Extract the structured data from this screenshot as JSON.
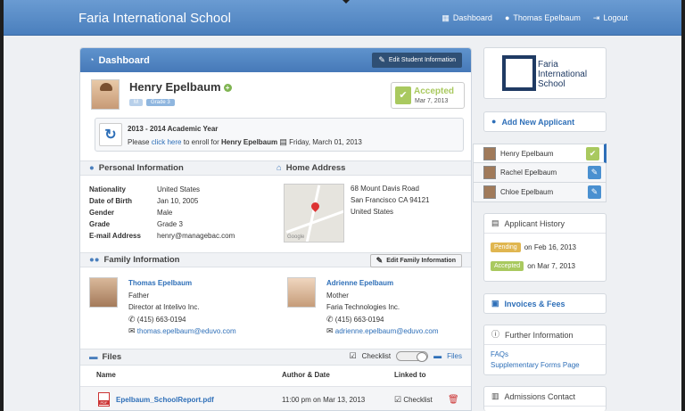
{
  "header": {
    "brand": "Faria International School",
    "nav": [
      {
        "label": "Dashboard",
        "icon": "dashboard-icon"
      },
      {
        "label": "Thomas Epelbaum",
        "icon": "user-icon"
      },
      {
        "label": "Logout",
        "icon": "logout-icon"
      }
    ]
  },
  "dashboard": {
    "title": "Dashboard",
    "edit_student_label": "Edit Student Information"
  },
  "student": {
    "name": "Henry Epelbaum",
    "tag_short": "M",
    "tag_grade": "Grade 3",
    "status": "Accepted",
    "status_date": "Mar 7, 2013"
  },
  "enroll": {
    "year": "2013 - 2014 Academic Year",
    "prefix": "Please",
    "link": "click here",
    "middle": "to enroll for",
    "name": "Henry Epelbaum",
    "date": "Friday, March 01, 2013"
  },
  "personal": {
    "title": "Personal Information",
    "fields": [
      {
        "k": "Nationality",
        "v": "United States"
      },
      {
        "k": "Date of Birth",
        "v": "Jan 10, 2005"
      },
      {
        "k": "Gender",
        "v": "Male"
      },
      {
        "k": "Grade",
        "v": "Grade 3"
      },
      {
        "k": "E-mail Address",
        "v": "henry@managebac.com"
      }
    ]
  },
  "address": {
    "title": "Home Address",
    "line1": "68 Mount Davis Road",
    "line2": "San Francisco CA 94121",
    "line3": "United States",
    "map_label": "Google"
  },
  "family": {
    "title": "Family Information",
    "edit_label": "Edit Family Information",
    "father": {
      "name": "Thomas Epelbaum",
      "role": "Father",
      "job": "Director at Intelivo Inc.",
      "phone": "(415) 663-0194",
      "email": "thomas.epelbaum@eduvo.com"
    },
    "mother": {
      "name": "Adrienne Epelbaum",
      "role": "Mother",
      "job": "Faria Technologies Inc.",
      "phone": "(415) 663-0194",
      "email": "adrienne.epelbaum@eduvo.com"
    }
  },
  "files": {
    "title": "Files",
    "checklist_label": "Checklist",
    "files_label": "Files",
    "col_name": "Name",
    "col_author": "Author & Date",
    "col_linked": "Linked to",
    "row": {
      "name": "Epelbaum_SchoolReport.pdf",
      "date": "11:00 pm on Mar 13, 2013",
      "linked": "Checklist"
    }
  },
  "sidebar": {
    "logo_line1": "Faria",
    "logo_line2": "International",
    "logo_line3": "School",
    "add_applicant": "Add New Applicant",
    "applicants": [
      {
        "name": "Henry Epelbaum",
        "state": "accepted"
      },
      {
        "name": "Rachel Epelbaum",
        "state": "pending"
      },
      {
        "name": "Chloe Epelbaum",
        "state": "pending"
      }
    ],
    "history_title": "Applicant History",
    "history": [
      {
        "badge": "Pending",
        "text": "on Feb 16, 2013"
      },
      {
        "badge": "Accepted",
        "text": "on Mar 7, 2013"
      }
    ],
    "invoices": "Invoices & Fees",
    "further_title": "Further Information",
    "faqs": "FAQs",
    "supplementary": "Supplementary Forms Page",
    "contact_title": "Admissions Contact"
  },
  "colors": {
    "header_blue": "#4a7fbd",
    "link_blue": "#2e6fb8",
    "accepted_green": "#a9c95f",
    "pending_yellow": "#e0b650"
  }
}
